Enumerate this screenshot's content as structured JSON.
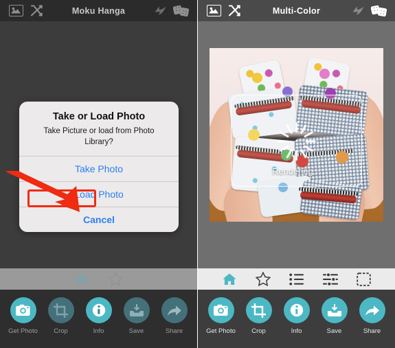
{
  "left_panel": {
    "header": {
      "title": "Moku Hanga",
      "icons": [
        "photo-frame-icon",
        "shuffle-icon",
        "undo-icon",
        "dice-icon"
      ]
    },
    "dialog": {
      "title": "Take or Load Photo",
      "message": "Take Picture or load from Photo Library?",
      "buttons": [
        {
          "label": "Take Photo",
          "style": "normal",
          "highlighted": false
        },
        {
          "label": "Load Photo",
          "style": "normal",
          "highlighted": true
        },
        {
          "label": "Cancel",
          "style": "bold",
          "highlighted": false
        }
      ]
    },
    "tabs": [
      {
        "name": "home-tab",
        "icon": "home-icon",
        "active": true
      },
      {
        "name": "favorites-tab",
        "icon": "star-icon",
        "active": false
      }
    ],
    "toolbar": [
      {
        "label": "Get Photo",
        "icon": "camera-icon"
      },
      {
        "label": "Crop",
        "icon": "crop-icon"
      },
      {
        "label": "Info",
        "icon": "info-icon"
      },
      {
        "label": "Save",
        "icon": "save-icon"
      },
      {
        "label": "Share",
        "icon": "share-icon"
      }
    ],
    "annotation": {
      "shape": "arrow-and-box",
      "color": "#ef2b11",
      "points_to": "Load Photo"
    }
  },
  "right_panel": {
    "header": {
      "title": "Multi-Color",
      "icons": [
        "photo-frame-icon",
        "shuffle-icon",
        "undo-icon",
        "dice-icon"
      ]
    },
    "canvas": {
      "photo_description": "Hands holding colorful patterned zipper pouches",
      "status_label": "Rendering...",
      "spinner": "activity-indicator"
    },
    "tabs": [
      {
        "name": "home-tab",
        "icon": "home-icon",
        "active": true
      },
      {
        "name": "favorites-tab",
        "icon": "star-icon",
        "active": false
      },
      {
        "name": "presets-tab",
        "icon": "list-icon",
        "active": false
      },
      {
        "name": "adjust-tab",
        "icon": "sliders-icon",
        "active": false
      },
      {
        "name": "frame-tab",
        "icon": "frame-icon",
        "active": false
      }
    ],
    "toolbar": [
      {
        "label": "Get Photo",
        "icon": "camera-icon"
      },
      {
        "label": "Crop",
        "icon": "crop-icon"
      },
      {
        "label": "Info",
        "icon": "info-icon"
      },
      {
        "label": "Save",
        "icon": "save-icon"
      },
      {
        "label": "Share",
        "icon": "share-icon"
      }
    ]
  },
  "colors": {
    "accent_teal": "#4cb8c4",
    "link_blue": "#2b7ff5",
    "annotation_red": "#ef2b11",
    "dialog_bg": "#eceaea",
    "left_bg": "#4a4a4a",
    "right_bg": "#6f6f6f"
  }
}
